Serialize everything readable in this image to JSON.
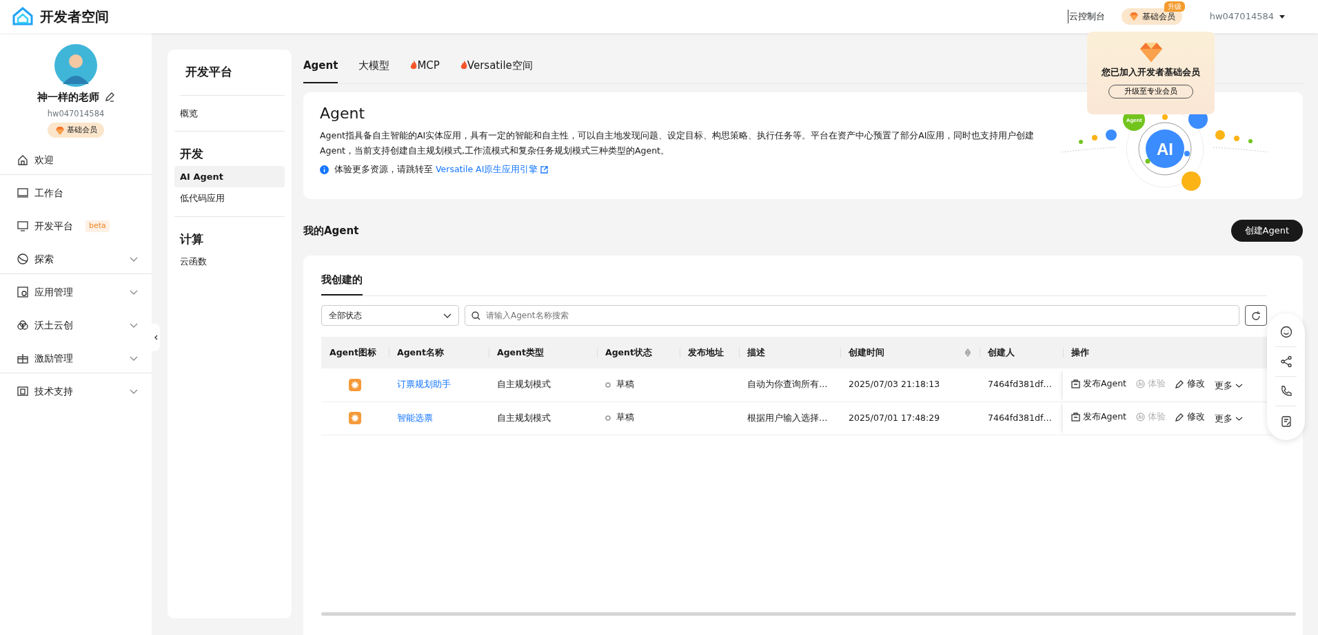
{
  "header": {
    "logo_text": "开发者空间",
    "console_link": "云控制台",
    "member_badge": "基础会员",
    "upgrade_tag": "升级",
    "username": "hw047014584"
  },
  "membership_popup": {
    "title": "您已加入开发者基础会员",
    "button": "升级至专业会员"
  },
  "profile": {
    "name": "神一样的老师",
    "user_id": "hw047014584",
    "member_badge": "基础会员"
  },
  "sidebar": {
    "items": [
      {
        "label": "欢迎",
        "expandable": false,
        "divider": true
      },
      {
        "label": "工作台",
        "expandable": false,
        "divider": false
      },
      {
        "label": "开发平台",
        "badge": "beta",
        "expandable": false,
        "divider": false
      },
      {
        "label": "探索",
        "expandable": true,
        "divider": true
      },
      {
        "label": "应用管理",
        "expandable": true,
        "divider": false
      },
      {
        "label": "沃土云创",
        "expandable": true,
        "divider": false
      },
      {
        "label": "激励管理",
        "expandable": true,
        "divider": true
      },
      {
        "label": "技术支持",
        "expandable": true,
        "divider": false
      }
    ]
  },
  "sub_nav": {
    "title": "开发平台",
    "groups": [
      {
        "items": [
          {
            "label": "概览",
            "selected": false
          }
        ]
      },
      {
        "heading": "开发",
        "items": [
          {
            "label": "AI Agent",
            "selected": true
          },
          {
            "label": "低代码应用",
            "selected": false
          }
        ]
      },
      {
        "heading": "计算",
        "items": [
          {
            "label": "云函数",
            "selected": false
          }
        ]
      }
    ]
  },
  "tabs": [
    {
      "label": "Agent",
      "selected": true,
      "hot": false
    },
    {
      "label": "大模型",
      "selected": false,
      "hot": false
    },
    {
      "label": "MCP",
      "selected": false,
      "hot": true
    },
    {
      "label": "Versatile空间",
      "selected": false,
      "hot": true
    }
  ],
  "intro": {
    "title": "Agent",
    "description": "Agent指具备自主智能的AI实体应用，具有一定的智能和自主性，可以自主地发现问题、设定目标、构思策略、执行任务等。平台在资产中心预置了部分AI应用，同时也支持用户创建Agent，当前支持创建自主规划模式,工作流模式和复杂任务规划模式三种类型的Agent。",
    "tip": "体验更多资源，请跳转至",
    "link": "Versatile AI原生应用引擎",
    "illustration": {
      "center_label": "AI",
      "bubble_label": "Agent"
    }
  },
  "my_agents": {
    "title": "我的Agent",
    "create_button": "创建Agent"
  },
  "list": {
    "tabs": [
      {
        "label": "我创建的",
        "selected": true
      }
    ],
    "status_filter": "全部状态",
    "search_placeholder": "请输入Agent名称搜索",
    "table": {
      "columns": [
        "Agent图标",
        "Agent名称",
        "Agent类型",
        "Agent状态",
        "发布地址",
        "描述",
        "创建时间",
        "创建人",
        "操作"
      ],
      "rows": [
        {
          "name": "订票规划助手",
          "type": "自主规划模式",
          "status": "草稿",
          "description": "自动为你查询所有…",
          "created": "2025/07/03 21:18:13",
          "creator": "7464fd381df…",
          "actions": [
            {
              "label": "发布Agent",
              "disabled": false
            },
            {
              "label": "体验",
              "disabled": true
            },
            {
              "label": "修改",
              "disabled": false
            },
            {
              "label": "更多",
              "disabled": false
            }
          ]
        },
        {
          "name": "智能选票",
          "type": "自主规划模式",
          "status": "草稿",
          "description": "根据用户输入选择…",
          "created": "2025/07/01 17:48:29",
          "creator": "7464fd381df…",
          "actions": [
            {
              "label": "发布Agent",
              "disabled": false
            },
            {
              "label": "体验",
              "disabled": true
            },
            {
              "label": "修改",
              "disabled": false
            },
            {
              "label": "更多",
              "disabled": false
            }
          ]
        }
      ]
    }
  }
}
